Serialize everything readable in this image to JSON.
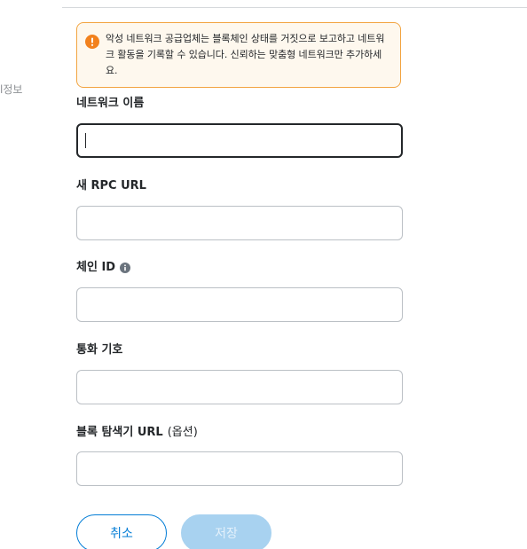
{
  "side_label": "l정보",
  "warning": {
    "icon": "warning-circle-icon",
    "color": "#f2a441",
    "text": "악성 네트워크 공급업체는 블록체인 상태를 거짓으로 보고하고 네트워크 활동을 기록할 수 있습니다. 신뢰하는 맞춤형 네트워크만 추가하세요."
  },
  "form": {
    "network_name": {
      "label": "네트워크 이름",
      "value": ""
    },
    "rpc_url": {
      "label": "새 RPC URL",
      "value": ""
    },
    "chain_id": {
      "label": "체인 ID",
      "info_icon": "info-icon",
      "value": ""
    },
    "currency_symbol": {
      "label": "통화 기호",
      "value": ""
    },
    "block_explorer": {
      "label": "블록 탐색기 URL",
      "optional": "(옵션)",
      "value": ""
    }
  },
  "buttons": {
    "cancel": "취소",
    "save": "저장"
  },
  "colors": {
    "accent": "#037dd6",
    "disabled": "#a8d2f0"
  }
}
